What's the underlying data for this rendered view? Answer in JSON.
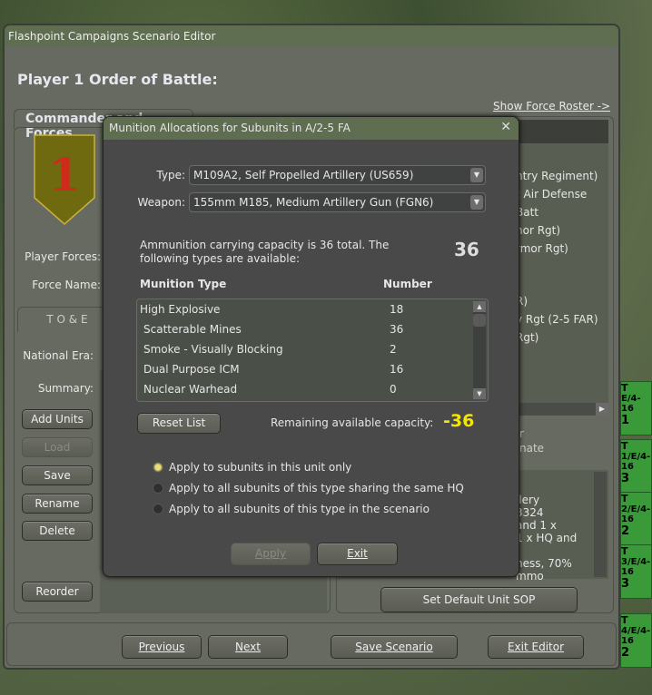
{
  "window": {
    "title": "Flashpoint Campaigns Scenario Editor",
    "heading": "Player 1 Order of Battle:"
  },
  "left": {
    "tab": "Commander and Forces",
    "badge_numeral": "1",
    "player_forces_label": "Player Forces:",
    "force_name_label": "Force Name:",
    "toe_tab": "T O & E",
    "national_era_label": "National Era:",
    "summary_label": "Summary:",
    "buttons": {
      "add_units": "Add Units",
      "load": "Load",
      "save": "Save",
      "rename": "Rename",
      "delete": "Delete",
      "reorder": "Reorder"
    }
  },
  "right": {
    "show_roster": "Show Force Roster ->",
    "list_fragments": [
      "ntry Regiment)",
      "t Air Defense Batt",
      "nor Rgt)",
      "rmor Rgt)",
      "R)",
      "y Rgt   (2-5 FAR)",
      "Rgt)"
    ],
    "mid_fragments": [
      "r",
      "nate"
    ],
    "text_fragments": [
      "llery",
      "3324",
      "and 1 x",
      "1 x HQ and",
      "ness, 70%",
      "mmo"
    ],
    "set_sop": "Set Default Unit SOP"
  },
  "footer": {
    "previous": "Previous",
    "next": "Next",
    "save_scenario": "Save Scenario",
    "exit_editor": "Exit Editor"
  },
  "dialog": {
    "title": "Munition Allocations for Subunits in A/2-5 FA",
    "close": "✕",
    "type_label": "Type:",
    "type_value": "M109A2, Self Propelled Artillery   (US659)",
    "weapon_label": "Weapon:",
    "weapon_value": "155mm M185, Medium Artillery Gun   (FGN6)",
    "capacity_text": "Ammunition carrying capacity is 36 total.  The following types are available:",
    "capacity_value": "36",
    "col_type": "Munition Type",
    "col_number": "Number",
    "munitions": [
      {
        "name": "High Explosive",
        "number": "18"
      },
      {
        "name": "Scatterable Mines",
        "number": "36"
      },
      {
        "name": "Smoke - Visually Blocking",
        "number": "2"
      },
      {
        "name": "Dual Purpose ICM",
        "number": "16"
      },
      {
        "name": "Nuclear Warhead",
        "number": "0"
      }
    ],
    "reset": "Reset List",
    "remaining_label": "Remaining available capacity:",
    "remaining_value": "-36",
    "remaining_color": "#f5e600",
    "options": [
      "Apply to subunits in this unit only",
      "Apply to all subunits of this type sharing the same HQ",
      "Apply to all subunits of this type in the scenario"
    ],
    "selected_option": 0,
    "apply": "Apply",
    "exit": "Exit"
  },
  "map_counters": [
    {
      "id": "E/4-16",
      "n": "1"
    },
    {
      "id": "1/E/4-16",
      "n": "3"
    },
    {
      "id": "2/E/4-16",
      "n": "2"
    },
    {
      "id": "3/E/4-16",
      "n": "3"
    },
    {
      "id": "4/E/4-16",
      "n": "2"
    }
  ]
}
